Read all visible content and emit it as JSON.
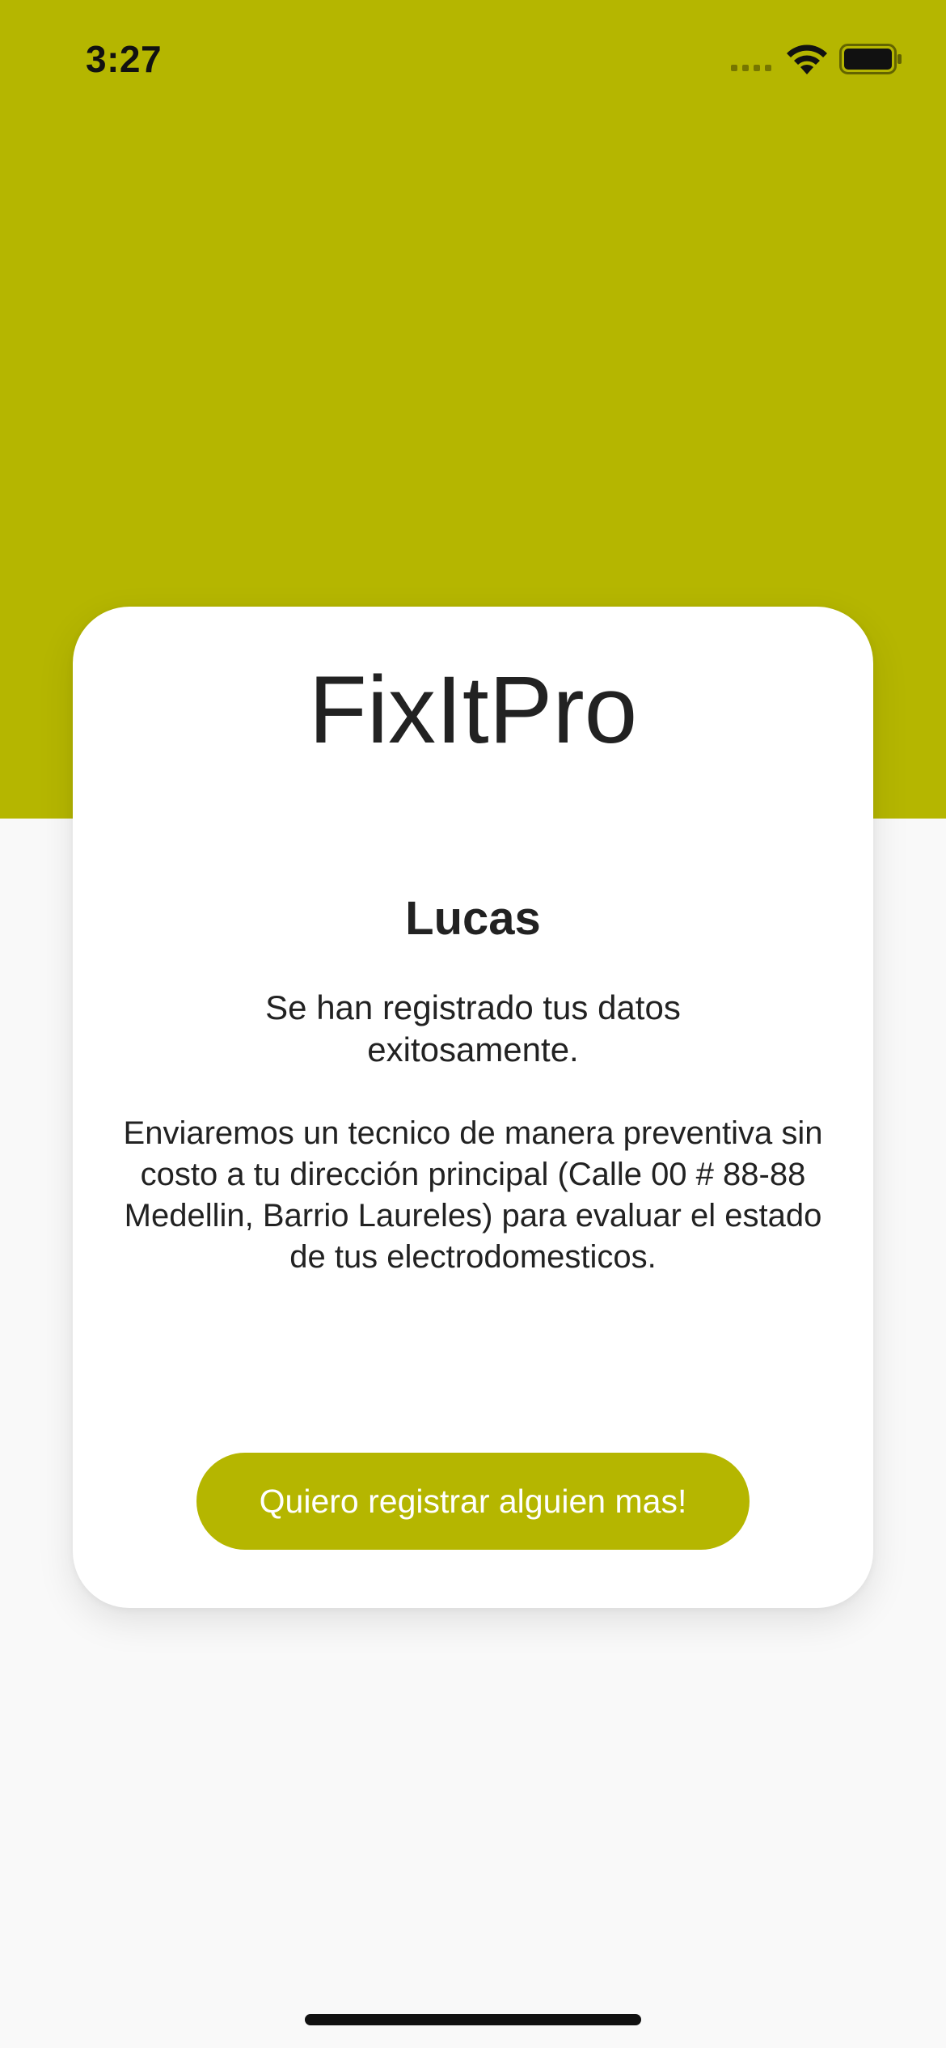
{
  "status_bar": {
    "time": "3:27",
    "icons": [
      "cellular-signal-icon",
      "wifi-icon",
      "battery-icon"
    ]
  },
  "colors": {
    "brand": "#B5B600",
    "background": "#F9F9F9",
    "card": "#FFFFFF",
    "text": "#222222",
    "button_text": "#FFFFFF"
  },
  "card": {
    "app_title": "FixItPro",
    "user_name": "Lucas",
    "success_message": "Se han registrado tus datos exitosamente.",
    "info_message": "Enviaremos un tecnico de manera preventiva sin costo a tu dirección principal (Calle 00 # 88-88 Medellin, Barrio Laureles) para evaluar el estado de tus electrodomesticos.",
    "button_label": "Quiero registrar alguien mas!"
  }
}
